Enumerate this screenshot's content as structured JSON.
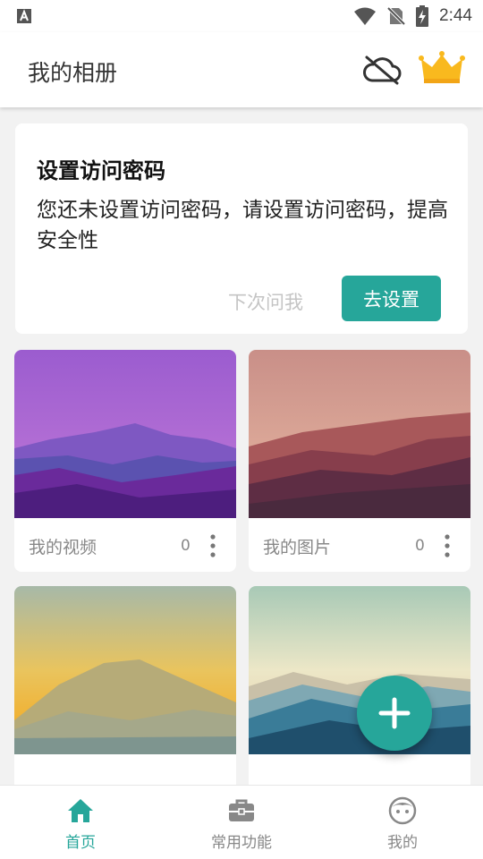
{
  "status_bar": {
    "time": "2:44",
    "notification_icon": "a-box-icon"
  },
  "app_bar": {
    "title": "我的相册",
    "cloud_icon": "cloud-off-icon",
    "crown_icon": "crown-icon"
  },
  "password_dialog": {
    "title": "设置访问密码",
    "message": "您还未设置访问密码，请设置访问密码，提高安全性",
    "later_label": "下次问我",
    "setup_label": "去设置"
  },
  "albums": [
    {
      "name": "我的视频",
      "count": "0",
      "theme": "purple"
    },
    {
      "name": "我的图片",
      "count": "0",
      "theme": "rose"
    },
    {
      "name": "",
      "count": "",
      "theme": "gold"
    },
    {
      "name": "",
      "count": "",
      "theme": "teal"
    }
  ],
  "fab": {
    "icon": "plus-icon"
  },
  "bottom_nav": {
    "items": [
      {
        "label": "首页",
        "icon": "home-icon",
        "active": true
      },
      {
        "label": "常用功能",
        "icon": "briefcase-icon",
        "active": false
      },
      {
        "label": "我的",
        "icon": "face-icon",
        "active": false
      }
    ]
  },
  "colors": {
    "accent": "#26a69a",
    "inactive": "#888888",
    "crown": "#f9b91e"
  }
}
